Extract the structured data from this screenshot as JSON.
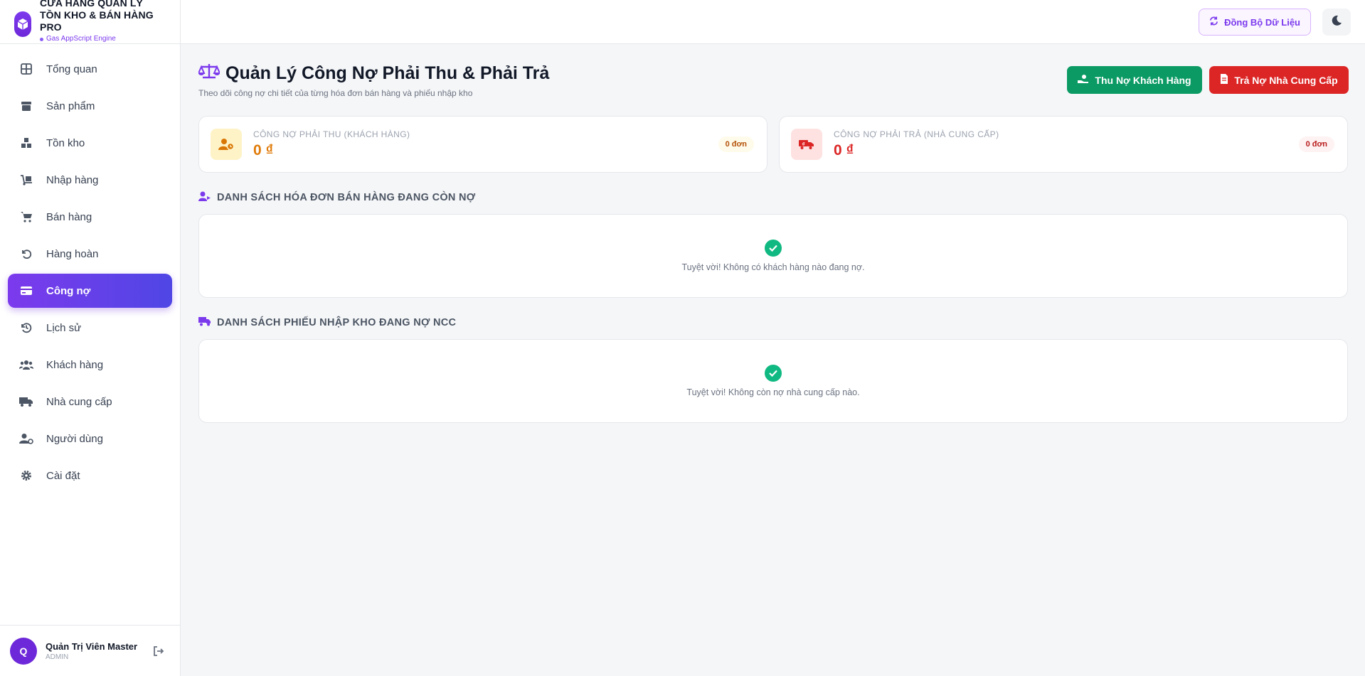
{
  "brand": {
    "title": "CỬA HÀNG QUẢN LÝ TỒN KHO & BÁN HÀNG PRO",
    "subtitle": "Gas AppScript Engine"
  },
  "nav": {
    "items": [
      {
        "label": "Tổng quan",
        "icon": "dashboard-icon"
      },
      {
        "label": "Sản phẩm",
        "icon": "box-icon"
      },
      {
        "label": "Tồn kho",
        "icon": "boxes-icon"
      },
      {
        "label": "Nhập hàng",
        "icon": "dolly-icon"
      },
      {
        "label": "Bán hàng",
        "icon": "cart-icon"
      },
      {
        "label": "Hàng hoàn",
        "icon": "undo-icon"
      },
      {
        "label": "Công nợ",
        "icon": "credit-card-icon",
        "active": true
      },
      {
        "label": "Lịch sử",
        "icon": "history-icon"
      },
      {
        "label": "Khách hàng",
        "icon": "users-icon"
      },
      {
        "label": "Nhà cung cấp",
        "icon": "truck-icon"
      },
      {
        "label": "Người dùng",
        "icon": "user-cog-icon"
      },
      {
        "label": "Cài đặt",
        "icon": "gear-icon"
      }
    ]
  },
  "user": {
    "initial": "Q",
    "name": "Quản Trị Viên Master",
    "role": "ADMIN"
  },
  "topbar": {
    "sync_label": "Đồng Bộ Dữ Liệu"
  },
  "page": {
    "title": "Quản Lý Công Nợ Phải Thu & Phải Trả",
    "subtitle": "Theo dõi công nợ chi tiết của từng hóa đơn bán hàng và phiếu nhập kho",
    "btn_collect": "Thu Nợ Khách Hàng",
    "btn_pay": "Trả Nợ Nhà Cung Cấp"
  },
  "cards": {
    "receivable": {
      "label": "CÔNG NỢ PHẢI THU (KHÁCH HÀNG)",
      "value": "0 ₫",
      "badge": "0 đơn",
      "color": "#e07b0a"
    },
    "payable": {
      "label": "CÔNG NỢ PHẢI TRẢ (NHÀ CUNG CẤP)",
      "value": "0 ₫",
      "badge": "0 đơn",
      "color": "#dc2626"
    }
  },
  "sections": {
    "invoices": {
      "title": "DANH SÁCH HÓA ĐƠN BÁN HÀNG ĐANG CÒN NỢ",
      "empty": "Tuyệt vời! Không có khách hàng nào đang nợ."
    },
    "receipts": {
      "title": "DANH SÁCH PHIẾU NHẬP KHO ĐANG NỢ NCC",
      "empty": "Tuyệt vời! Không còn nợ nhà cung cấp nào."
    }
  },
  "colors": {
    "accent": "#7c3aed",
    "green": "#0b9a64",
    "red": "#dc2626",
    "success": "#10b981"
  }
}
